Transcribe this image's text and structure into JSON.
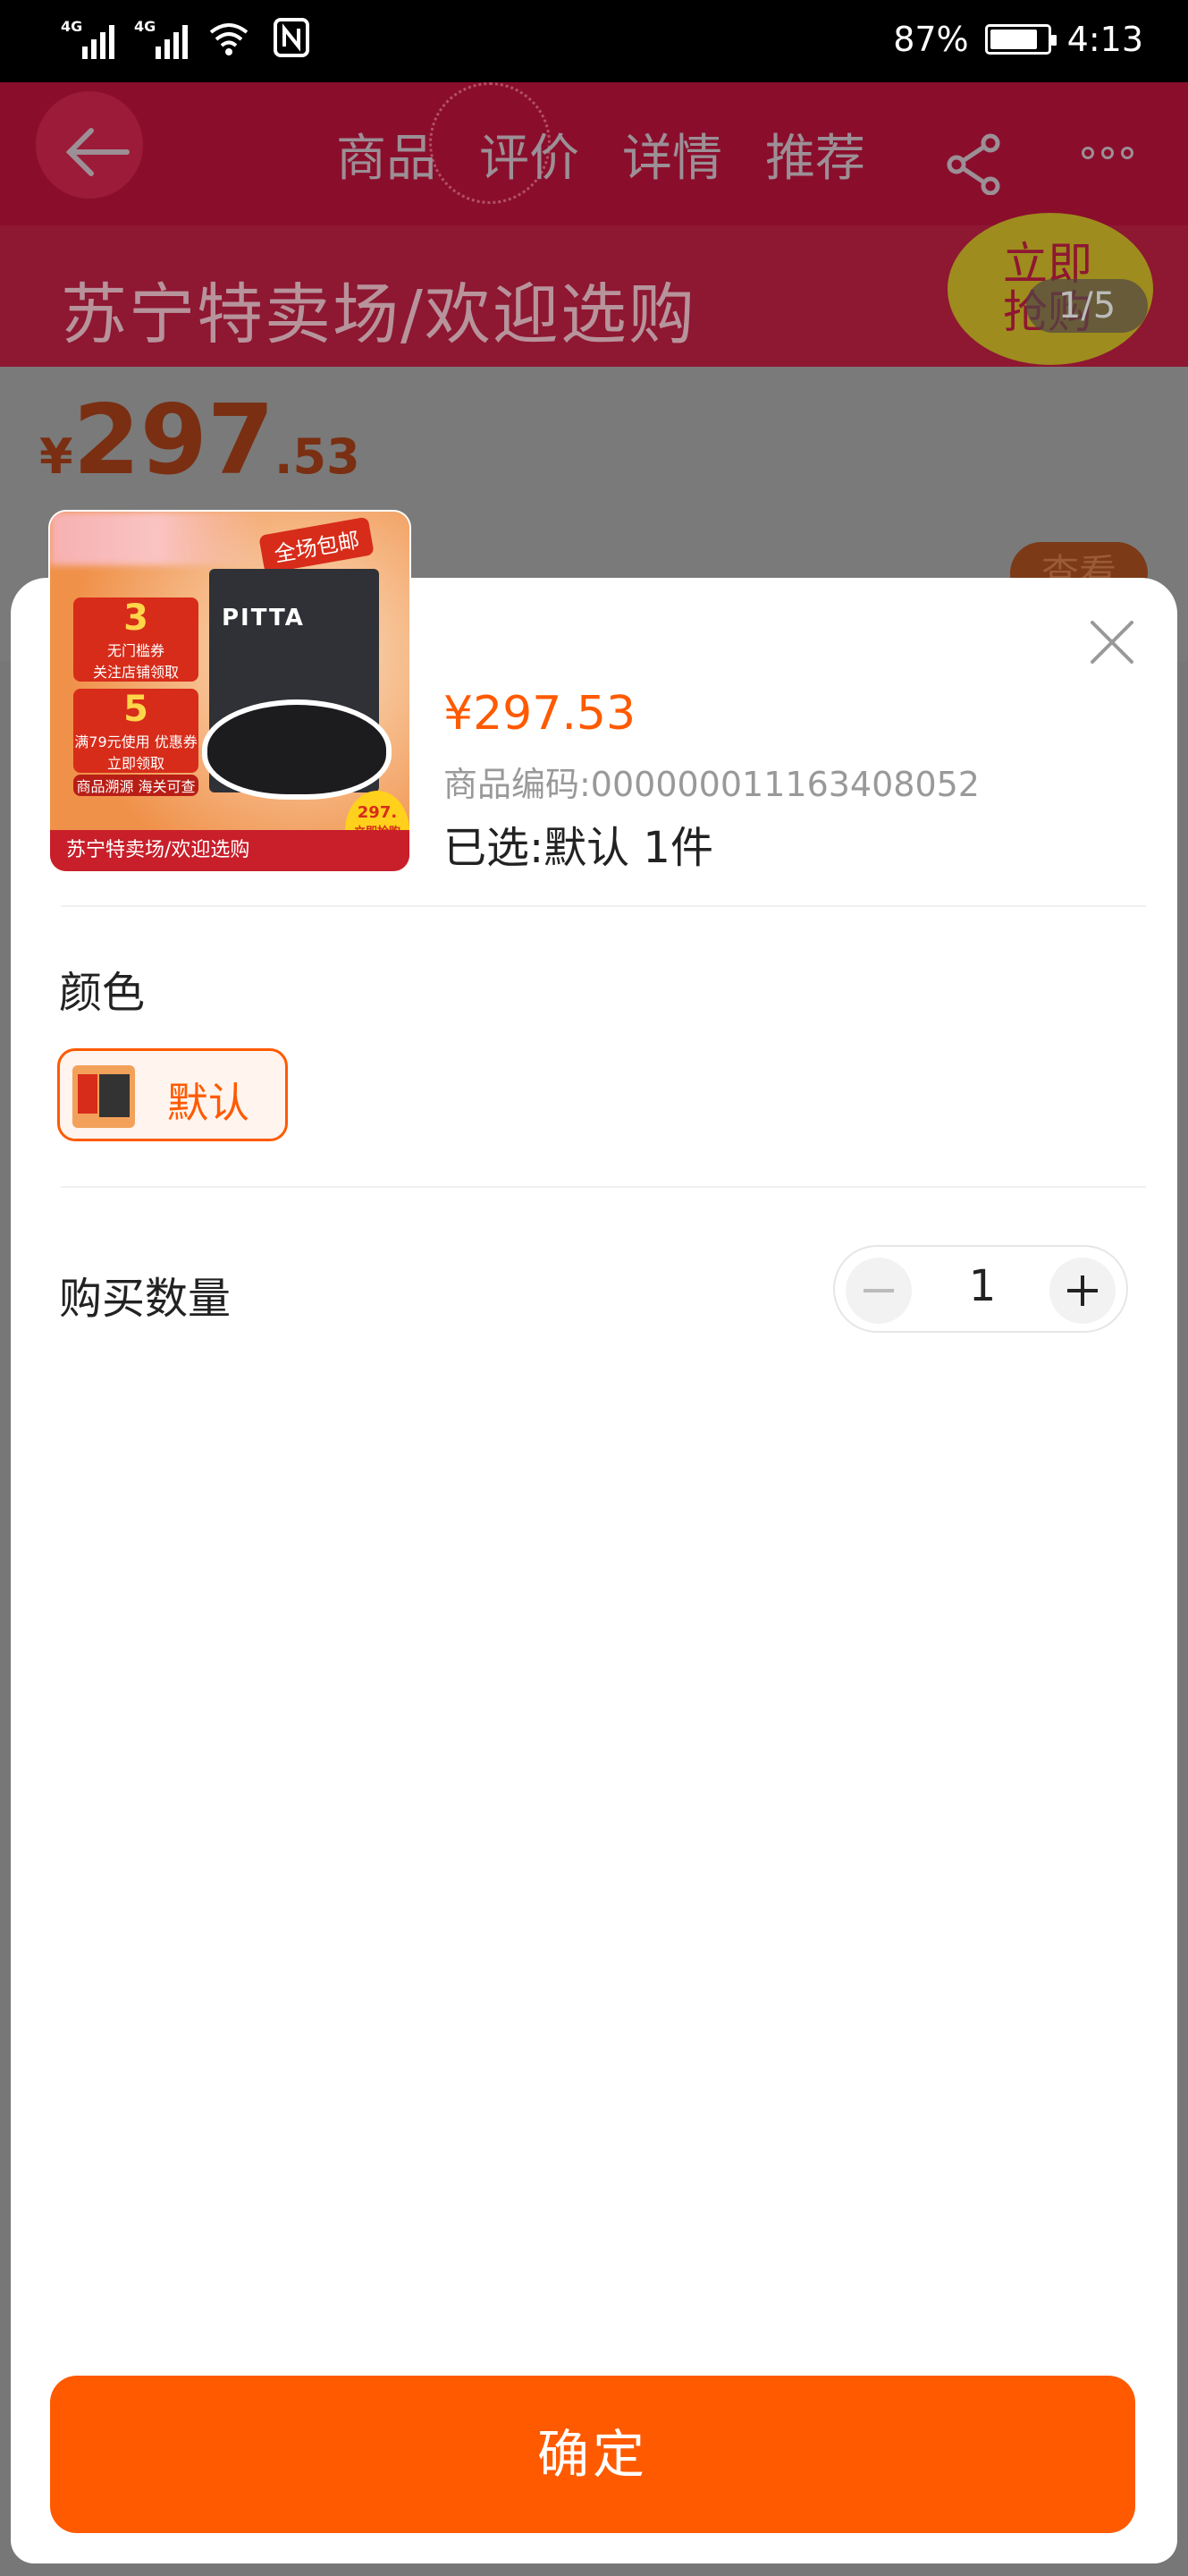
{
  "status_bar": {
    "signal1": "4G",
    "signal2": "4G",
    "battery_percent": "87%",
    "time": "4:13"
  },
  "header": {
    "tabs": [
      "商品",
      "评价",
      "详情",
      "推荐"
    ]
  },
  "banner": {
    "text": "苏宁特卖场/欢迎选购",
    "badge": "立即抢购",
    "page_indicator": "1/5"
  },
  "background_product": {
    "currency": "¥",
    "price_int": "297",
    "price_dec": ".53",
    "view_button": "查看"
  },
  "sheet": {
    "thumbnail": {
      "tag": "全场包邮",
      "coupon1_amount": "3",
      "coupon1_text": "无门槛券",
      "coupon1_action": "关注店铺领取",
      "coupon2_amount": "5",
      "coupon2_text": "满79元使用 优惠券",
      "coupon2_action": "立即领取",
      "origin_note": "商品溯源 海关可查",
      "brand": "PITTA",
      "footer": "苏宁特卖场/欢迎选购",
      "mini_price": "297.",
      "mini_badge": "立即抢购"
    },
    "price": "¥297.53",
    "code": "商品编码:000000011163408052",
    "selected": "已选:默认  1件",
    "color_section_title": "颜色",
    "color_option_label": "默认",
    "quantity_title": "购买数量",
    "quantity_value": "1",
    "confirm_label": "确定"
  },
  "colors": {
    "accent": "#ff5a00",
    "header_bg": "#8a0e2c",
    "overlay": "#777777"
  }
}
